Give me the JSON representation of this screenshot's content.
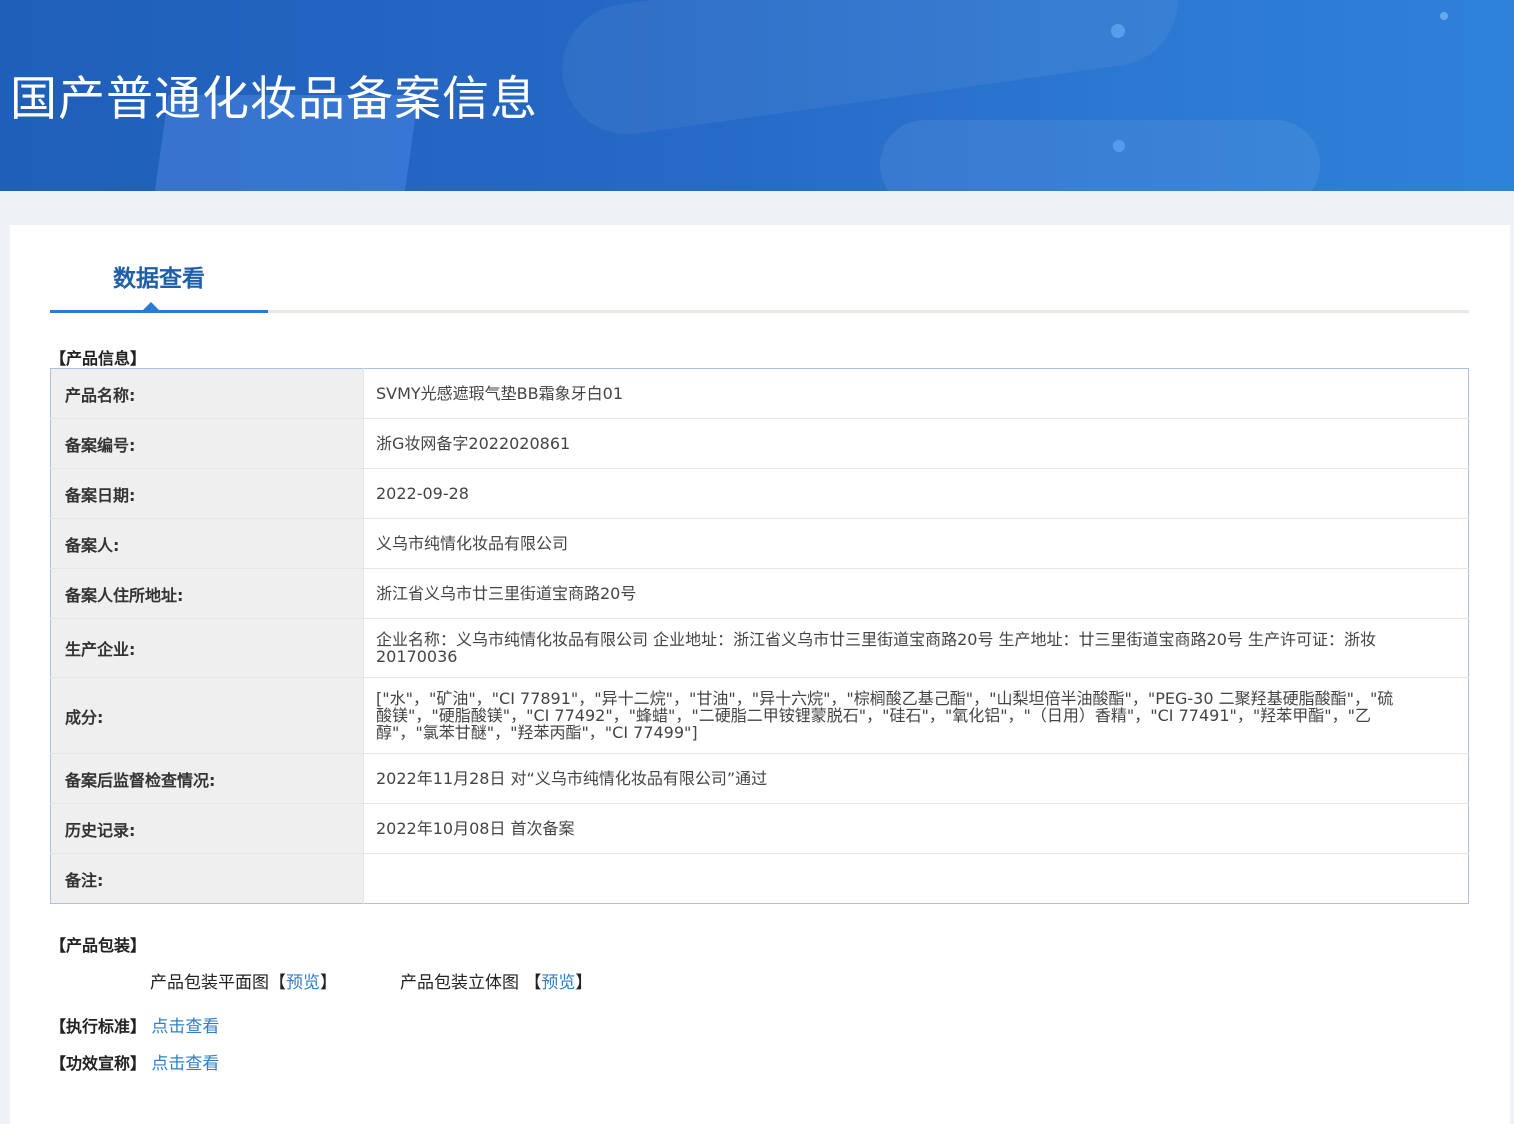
{
  "banner": {
    "title": "国产普通化妆品备案信息"
  },
  "tabs": [
    {
      "label": "数据查看"
    }
  ],
  "product_info": {
    "section_title": "【产品信息】",
    "rows": [
      {
        "key": "产品名称:",
        "value": "SVMY光感遮瑕气垫BB霜象牙白01"
      },
      {
        "key": "备案编号:",
        "value": "浙G妆网备字2022020861"
      },
      {
        "key": "备案日期:",
        "value": "2022-09-28"
      },
      {
        "key": "备案人:",
        "value": "义乌市纯情化妆品有限公司"
      },
      {
        "key": "备案人住所地址:",
        "value": "浙江省义乌市廿三里街道宝商路20号"
      },
      {
        "key": "生产企业:",
        "value": "企业名称：义乌市纯情化妆品有限公司 企业地址：浙江省义乌市廿三里街道宝商路20号 生产地址：廿三里街道宝商路20号 生产许可证：浙妆20170036"
      },
      {
        "key": "成分:",
        "value": "[\"水\"，\"矿油\"，\"CI 77891\"，\"异十二烷\"，\"甘油\"，\"异十六烷\"，\"棕榈酸乙基己酯\"，\"山梨坦倍半油酸酯\"，\"PEG-30 二聚羟基硬脂酸酯\"，\"硫酸镁\"，\"硬脂酸镁\"，\"CI 77492\"，\"蜂蜡\"，\"二硬脂二甲铵锂蒙脱石\"，\"硅石\"，\"氧化铝\"，\"（日用）香精\"，\"CI 77491\"，\"羟苯甲酯\"，\"乙醇\"，\"氯苯甘醚\"，\"羟苯丙酯\"，\"CI 77499\"]"
      },
      {
        "key": "备案后监督检查情况:",
        "value": "2022年11月28日 对“义乌市纯情化妆品有限公司”通过"
      },
      {
        "key": "历史记录:",
        "value": "2022年10月08日 首次备案"
      },
      {
        "key": "备注:",
        "value": ""
      }
    ]
  },
  "packaging": {
    "section_title": "【产品包装】",
    "flat_label": "产品包装平面图",
    "flat_link": "预览",
    "stereo_label": "产品包装立体图",
    "stereo_link": "预览",
    "bracket_open": "【",
    "bracket_close": "】"
  },
  "standard": {
    "label": "【执行标准】",
    "link": "点击查看"
  },
  "efficacy": {
    "label": "【功效宣称】",
    "link": "点击查看"
  },
  "colors": {
    "banner": "#2669c6",
    "accent": "#2a7bd2",
    "link": "#2f7fc8",
    "key_bg": "#efefef"
  }
}
